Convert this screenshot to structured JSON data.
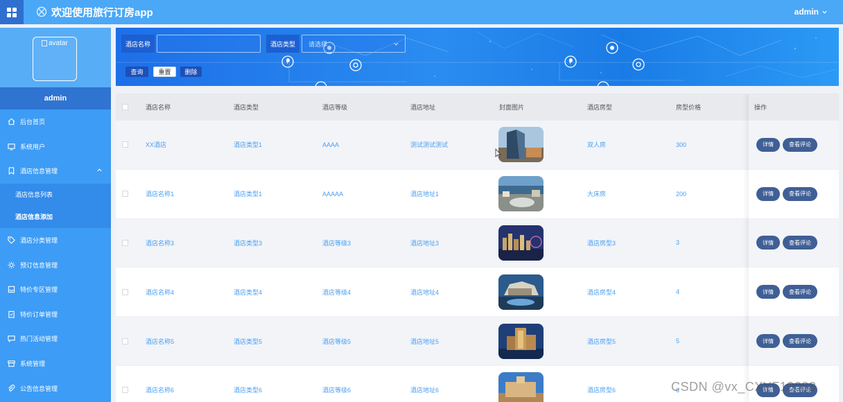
{
  "app": {
    "title": "欢迎使用旅行订房app",
    "user": "admin"
  },
  "sidebar": {
    "avatar_alt": "avatar",
    "username": "admin",
    "items": [
      {
        "label": "后台首页",
        "icon": "home-icon"
      },
      {
        "label": "系统用户",
        "icon": "monitor-icon"
      },
      {
        "label": "酒店信息管理",
        "icon": "bookmark-icon"
      },
      {
        "label": "酒店信息列表",
        "icon": ""
      },
      {
        "label": "酒店信息添加",
        "icon": ""
      },
      {
        "label": "酒店分类管理",
        "icon": "tag-icon"
      },
      {
        "label": "预订信息管理",
        "icon": "sun-icon"
      },
      {
        "label": "特价专区管理",
        "icon": "inbox-icon"
      },
      {
        "label": "特价订单管理",
        "icon": "clipboard-icon"
      },
      {
        "label": "热门活动管理",
        "icon": "chat-icon"
      },
      {
        "label": "系统管理",
        "icon": "box-icon"
      },
      {
        "label": "公告信息管理",
        "icon": "paperclip-icon"
      }
    ]
  },
  "search": {
    "name_label": "酒店名称",
    "name_value": "",
    "type_label": "酒店类型",
    "type_placeholder": "请选择",
    "query_button": "查询",
    "reset_button": "重置",
    "delete_button": "删除"
  },
  "table": {
    "headers": [
      "酒店名称",
      "酒店类型",
      "酒店等级",
      "酒店地址",
      "封面图片",
      "酒店房型",
      "房型价格",
      "操作"
    ],
    "detail_button": "详情",
    "review_button": "查看评论",
    "rows": [
      {
        "name": "XX酒店",
        "type": "酒店类型1",
        "level": "AAAA",
        "address": "测试测试测试",
        "room": "双人房",
        "price": "300"
      },
      {
        "name": "酒店名称1",
        "type": "酒店类型1",
        "level": "AAAAA",
        "address": "酒店地址1",
        "room": "大床房",
        "price": "200"
      },
      {
        "name": "酒店名称3",
        "type": "酒店类型3",
        "level": "酒店等级3",
        "address": "酒店地址3",
        "room": "酒店房型3",
        "price": "3"
      },
      {
        "name": "酒店名称4",
        "type": "酒店类型4",
        "level": "酒店等级4",
        "address": "酒店地址4",
        "room": "酒店房型4",
        "price": "4"
      },
      {
        "name": "酒店名称5",
        "type": "酒店类型5",
        "level": "酒店等级5",
        "address": "酒店地址5",
        "room": "酒店房型5",
        "price": "5"
      },
      {
        "name": "酒店名称6",
        "type": "酒店类型6",
        "level": "酒店等级6",
        "address": "酒店地址6",
        "room": "酒店房型6",
        "price": "6"
      }
    ]
  },
  "watermark": "CSDN @vx_CXYF10088",
  "colors": {
    "topbar": "#4aa8f7",
    "sidebar": "#3d9cf5",
    "accent": "#2f74d1",
    "link": "#4a9ff0",
    "op_button": "#3f5f96"
  }
}
